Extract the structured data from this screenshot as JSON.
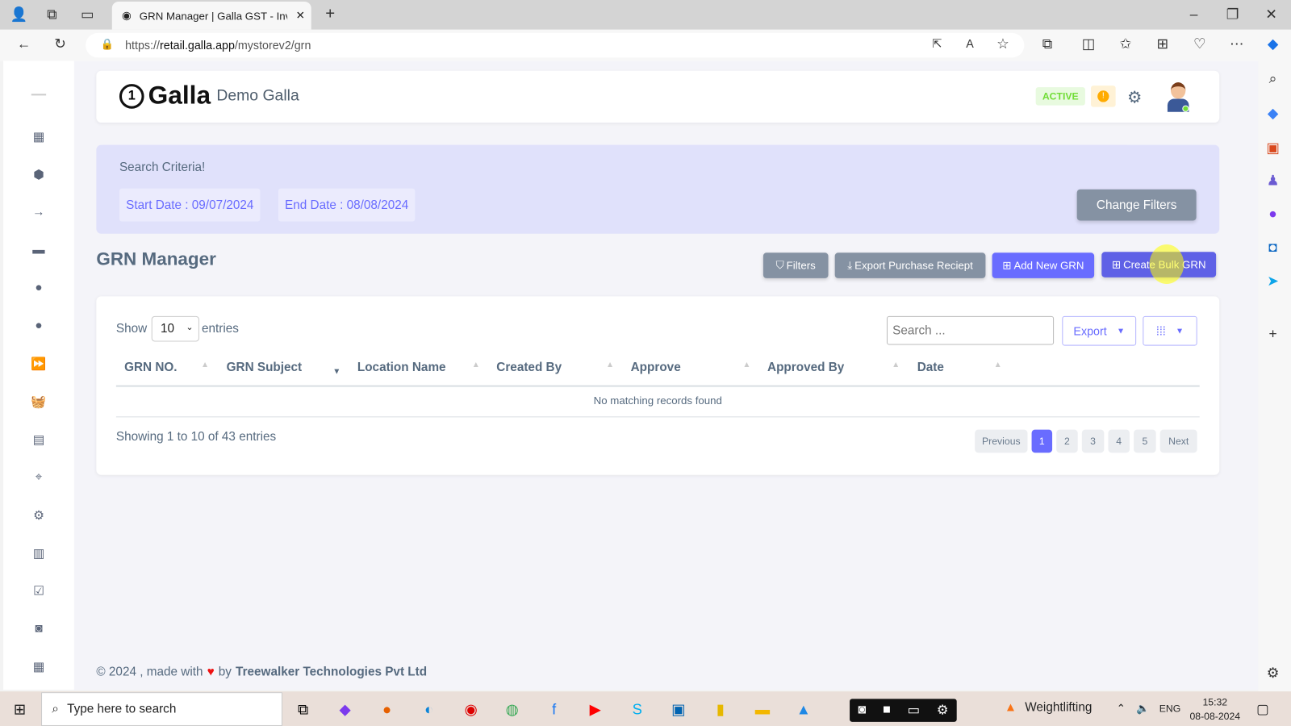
{
  "browser": {
    "tab_title": "GRN Manager | Galla GST - Inven",
    "url_prefix": "https://",
    "url_domain": "retail.galla.app",
    "url_path": "/mystorev2/grn"
  },
  "header": {
    "logo_text": "Galla",
    "store_name": "Demo Galla",
    "status": "ACTIVE",
    "notification": "!"
  },
  "search_criteria": {
    "title": "Search Criteria!",
    "start_date": "Start Date : 09/07/2024",
    "end_date": "End Date : 08/08/2024",
    "change_filters": "Change Filters"
  },
  "page": {
    "title": "GRN Manager",
    "filters": "Filters",
    "export_receipt": "Export Purchase Reciept",
    "add_new": "Add New GRN",
    "create_bulk": "Create Bulk GRN"
  },
  "table": {
    "show": "Show",
    "entries_value": "10",
    "entries": "entries",
    "search_placeholder": "Search ...",
    "export": "Export",
    "columns": [
      "GRN NO.",
      "GRN Subject",
      "Location Name",
      "Created By",
      "Approve",
      "Approved By",
      "Date"
    ],
    "empty": "No matching records found",
    "info": "Showing 1 to 10 of 43 entries",
    "pagination": {
      "previous": "Previous",
      "pages": [
        "1",
        "2",
        "3",
        "4",
        "5"
      ],
      "next": "Next",
      "current": "1"
    }
  },
  "footer": {
    "text": "© 2024 , made with",
    "by": "by",
    "company": "Treewalker Technologies Pvt Ltd"
  },
  "taskbar": {
    "search": "Type here to search",
    "weather": "Weightlifting",
    "lang": "ENG",
    "time": "15:32",
    "date": "08-08-2024"
  },
  "colors": {
    "primary": "#696cff",
    "secondary": "#8592a3",
    "active_badge": "#71dd37"
  }
}
